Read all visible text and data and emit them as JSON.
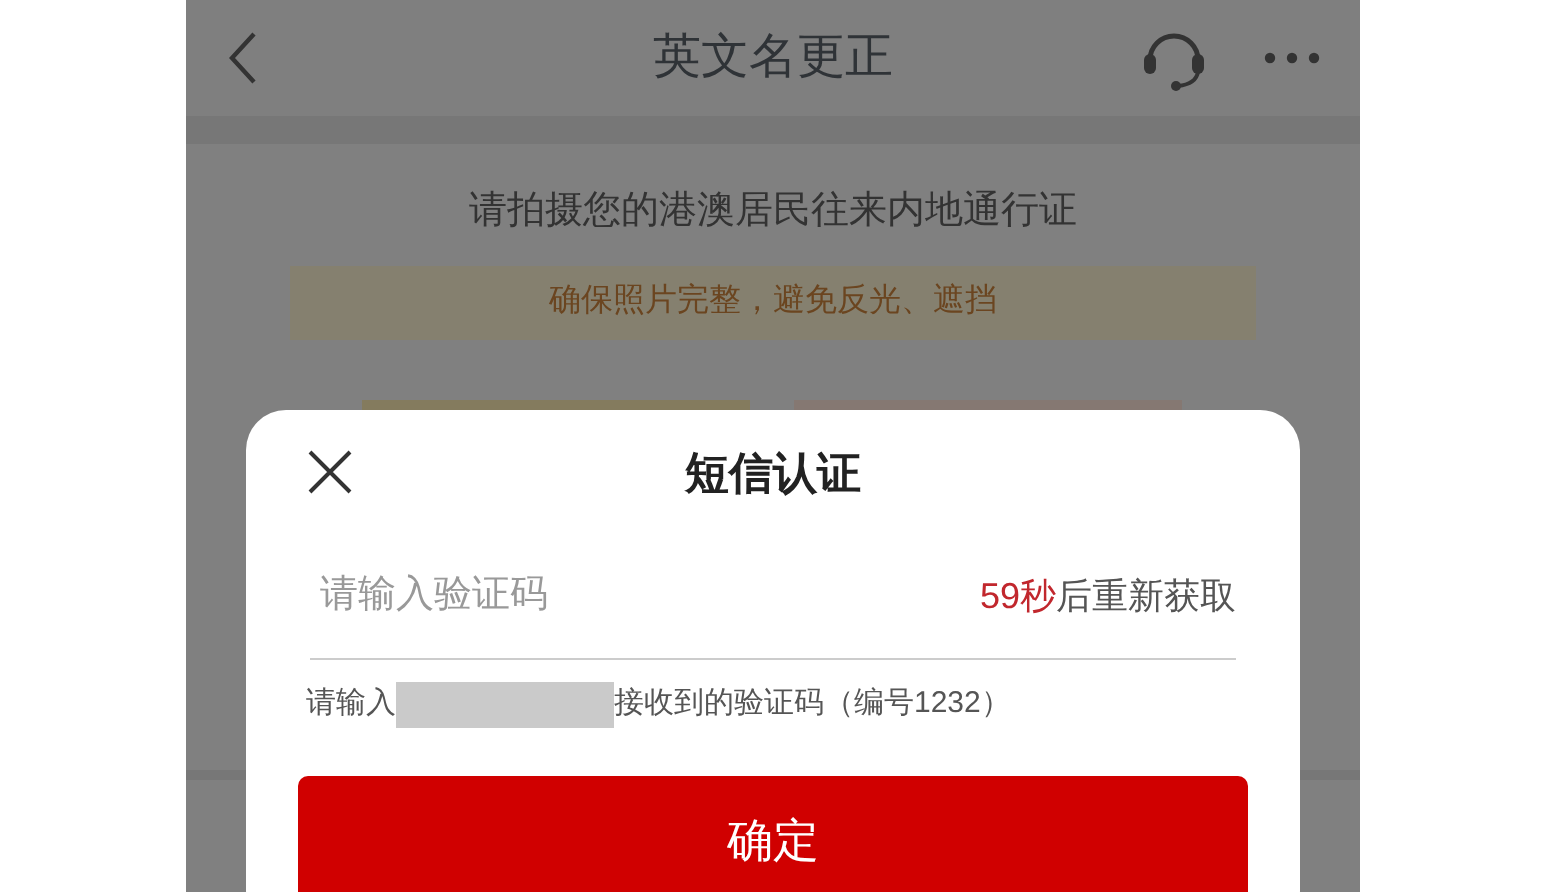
{
  "header": {
    "title": "英文名更正"
  },
  "instruction": "请拍摄您的港澳居民往来内地通行证",
  "notice": "确保照片完整，避免反光、遮挡",
  "dialog": {
    "title": "短信认证",
    "code_field": {
      "placeholder": "请输入验证码"
    },
    "resend": {
      "countdown": "59秒",
      "label": "后重新获取"
    },
    "hint_before": "请输入",
    "hint_after": "接收到的验证码（编号1232）",
    "confirm_button": "确定"
  }
}
